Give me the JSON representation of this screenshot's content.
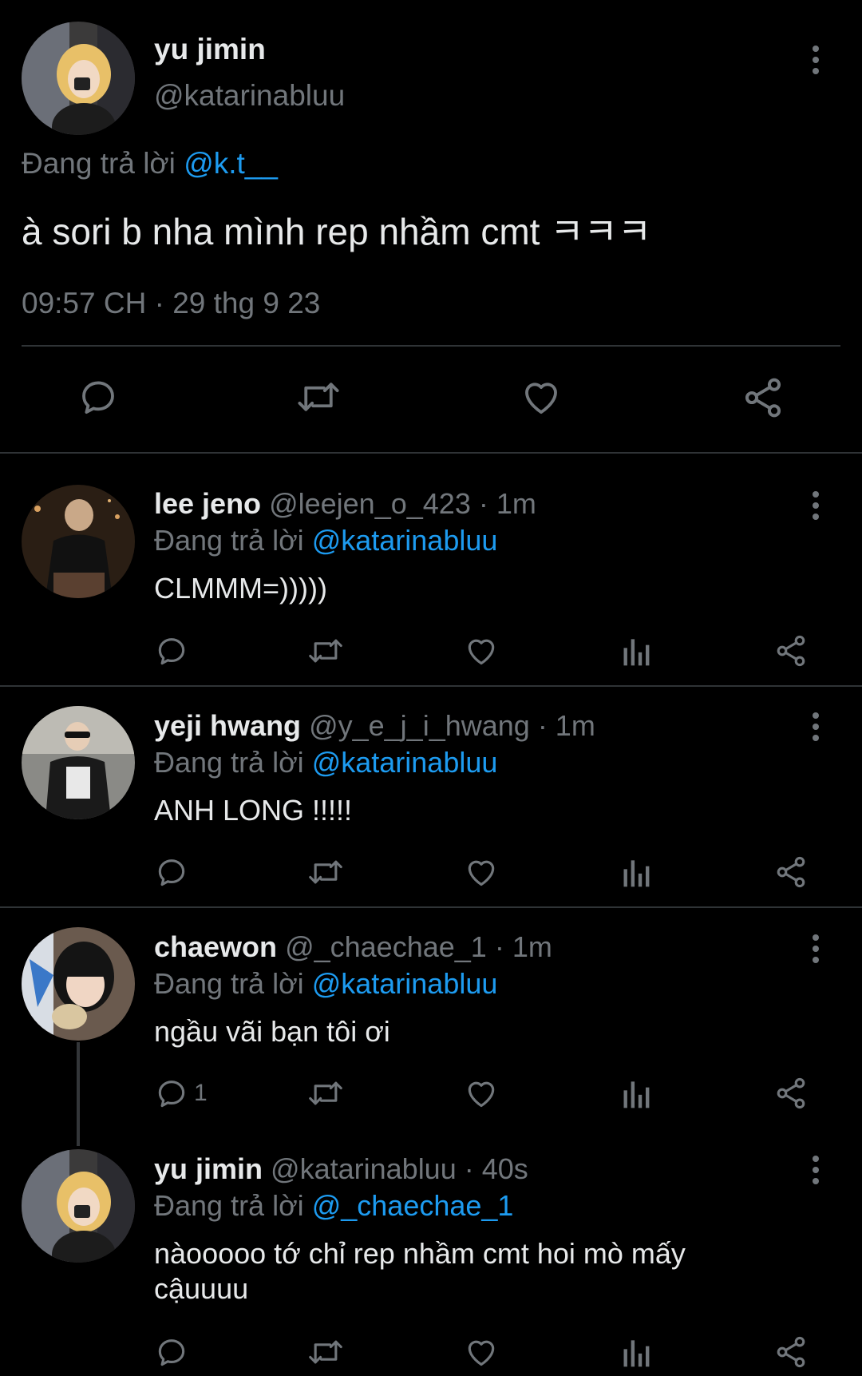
{
  "main_tweet": {
    "author_name": "yu jimin",
    "author_handle": "@katarinabluu",
    "replying_prefix": "Đang trả lời",
    "replying_to": "@k.t__",
    "text": "à sori b nha mình rep nhầm cmt ㅋㅋㅋ",
    "timestamp": "09:57 CH · 29 thg 9 23",
    "actions": [
      "reply-icon",
      "retweet-icon",
      "like-icon",
      "share-icon"
    ]
  },
  "replies": [
    {
      "name": "lee jeno",
      "handle": "@leejen_o_423",
      "time": "· 1m",
      "replying_prefix": "Đang trả lời",
      "replying_to": "@katarinabluu",
      "text": "CLMMM=)))))",
      "reply_count": ""
    },
    {
      "name": "yeji hwang",
      "handle": "@y_e_j_i_hwang",
      "time": "· 1m",
      "replying_prefix": "Đang trả lời",
      "replying_to": "@katarinabluu",
      "text": "ANH LONG !!!!!",
      "reply_count": ""
    },
    {
      "name": "chaewon",
      "handle": "@_chaechae_1",
      "time": "· 1m",
      "replying_prefix": "Đang trả lời",
      "replying_to": "@katarinabluu",
      "text": "ngầu vãi bạn tôi ơi",
      "reply_count": "1"
    },
    {
      "name": "yu jimin",
      "handle": "@katarinabluu",
      "time": "· 40s",
      "replying_prefix": "Đang trả lời",
      "replying_to": "@_chaechae_1",
      "text": "nàooooo tớ chỉ rep nhầm cmt hoi mò mấy cậuuuu",
      "reply_count": ""
    }
  ],
  "colors": {
    "background": "#000000",
    "text": "#e7e9ea",
    "muted": "#71767b",
    "link": "#1d9bf0",
    "divider": "#2f3336"
  }
}
